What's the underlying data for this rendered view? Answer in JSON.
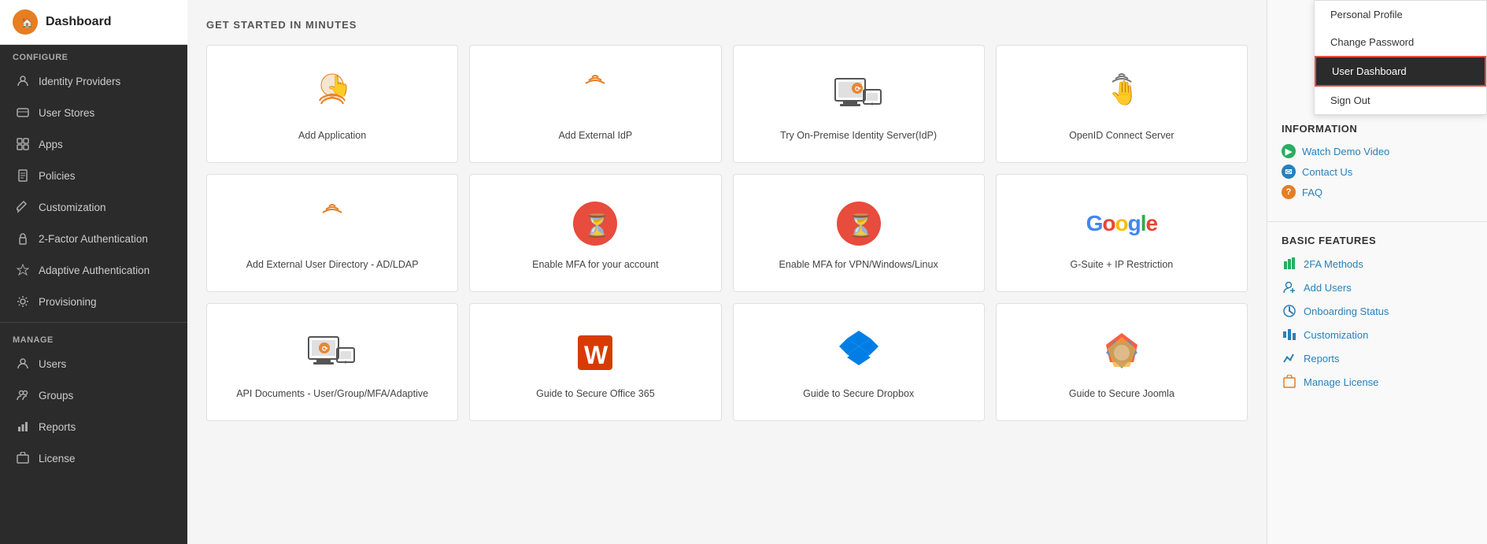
{
  "sidebar": {
    "logo": {
      "icon": "🏠",
      "title": "Dashboard"
    },
    "configure_label": "Configure",
    "items_configure": [
      {
        "id": "identity-providers",
        "label": "Identity Providers",
        "icon": "🔗"
      },
      {
        "id": "user-stores",
        "label": "User Stores",
        "icon": "🗄"
      },
      {
        "id": "apps",
        "label": "Apps",
        "icon": "⊞"
      },
      {
        "id": "policies",
        "label": "Policies",
        "icon": "📋"
      },
      {
        "id": "customization",
        "label": "Customization",
        "icon": "✏"
      },
      {
        "id": "2fa",
        "label": "2-Factor Authentication",
        "icon": "🔒"
      },
      {
        "id": "adaptive",
        "label": "Adaptive Authentication",
        "icon": "🛡"
      },
      {
        "id": "provisioning",
        "label": "Provisioning",
        "icon": "⚙"
      }
    ],
    "manage_label": "Manage",
    "items_manage": [
      {
        "id": "users",
        "label": "Users",
        "icon": "👤"
      },
      {
        "id": "groups",
        "label": "Groups",
        "icon": "👥"
      },
      {
        "id": "reports",
        "label": "Reports",
        "icon": "📊"
      },
      {
        "id": "license",
        "label": "License",
        "icon": "🔑"
      }
    ]
  },
  "main": {
    "section_title": "GET STARTED IN MINUTES",
    "cards": [
      {
        "id": "add-application",
        "label": "Add Application",
        "icon_type": "touch-orange"
      },
      {
        "id": "add-external-idp",
        "label": "Add External IdP",
        "icon_type": "touch-orange"
      },
      {
        "id": "try-on-premise",
        "label": "Try On-Premise Identity Server(IdP)",
        "icon_type": "devices-orange"
      },
      {
        "id": "openid-connect",
        "label": "OpenID Connect Server",
        "icon_type": "touch-dark"
      },
      {
        "id": "add-external-user-dir",
        "label": "Add External User Directory - AD/LDAP",
        "icon_type": "touch-orange"
      },
      {
        "id": "enable-mfa-account",
        "label": "Enable MFA for your account",
        "icon_type": "mfa-red"
      },
      {
        "id": "enable-mfa-vpn",
        "label": "Enable MFA for VPN/Windows/Linux",
        "icon_type": "mfa-red"
      },
      {
        "id": "gsuite-ip",
        "label": "G-Suite + IP Restriction",
        "icon_type": "google"
      },
      {
        "id": "api-documents",
        "label": "API Documents - User/Group/MFA/Adaptive",
        "icon_type": "devices-orange"
      },
      {
        "id": "guide-office365",
        "label": "Guide to Secure Office 365",
        "icon_type": "office365"
      },
      {
        "id": "guide-dropbox",
        "label": "Guide to Secure Dropbox",
        "icon_type": "dropbox"
      },
      {
        "id": "guide-joomla",
        "label": "Guide to Secure Joomla",
        "icon_type": "joomla"
      }
    ]
  },
  "dropdown": {
    "items": [
      {
        "id": "personal-profile",
        "label": "Personal Profile",
        "active": false
      },
      {
        "id": "change-password",
        "label": "Change Password",
        "active": false
      },
      {
        "id": "user-dashboard",
        "label": "User Dashboard",
        "active": true
      },
      {
        "id": "sign-out",
        "label": "Sign Out",
        "active": false
      }
    ]
  },
  "right_panel": {
    "information_title": "INFORMATION",
    "info_links": [
      {
        "id": "watch-demo",
        "label": "Watch Demo Video",
        "icon_color": "green"
      },
      {
        "id": "contact-us",
        "label": "Contact Us",
        "icon_color": "blue"
      },
      {
        "id": "faq",
        "label": "FAQ",
        "icon_color": "orange"
      }
    ],
    "basic_features_title": "BASIC FEATURES",
    "feature_links": [
      {
        "id": "2fa-methods",
        "label": "2FA Methods",
        "icon": "📊"
      },
      {
        "id": "add-users",
        "label": "Add Users",
        "icon": "👤"
      },
      {
        "id": "onboarding-status",
        "label": "Onboarding Status",
        "icon": "⭕"
      },
      {
        "id": "customization",
        "label": "Customization",
        "icon": "📶"
      },
      {
        "id": "reports",
        "label": "Reports",
        "icon": "📈"
      },
      {
        "id": "manage-license",
        "label": "Manage License",
        "icon": "📂"
      }
    ]
  }
}
